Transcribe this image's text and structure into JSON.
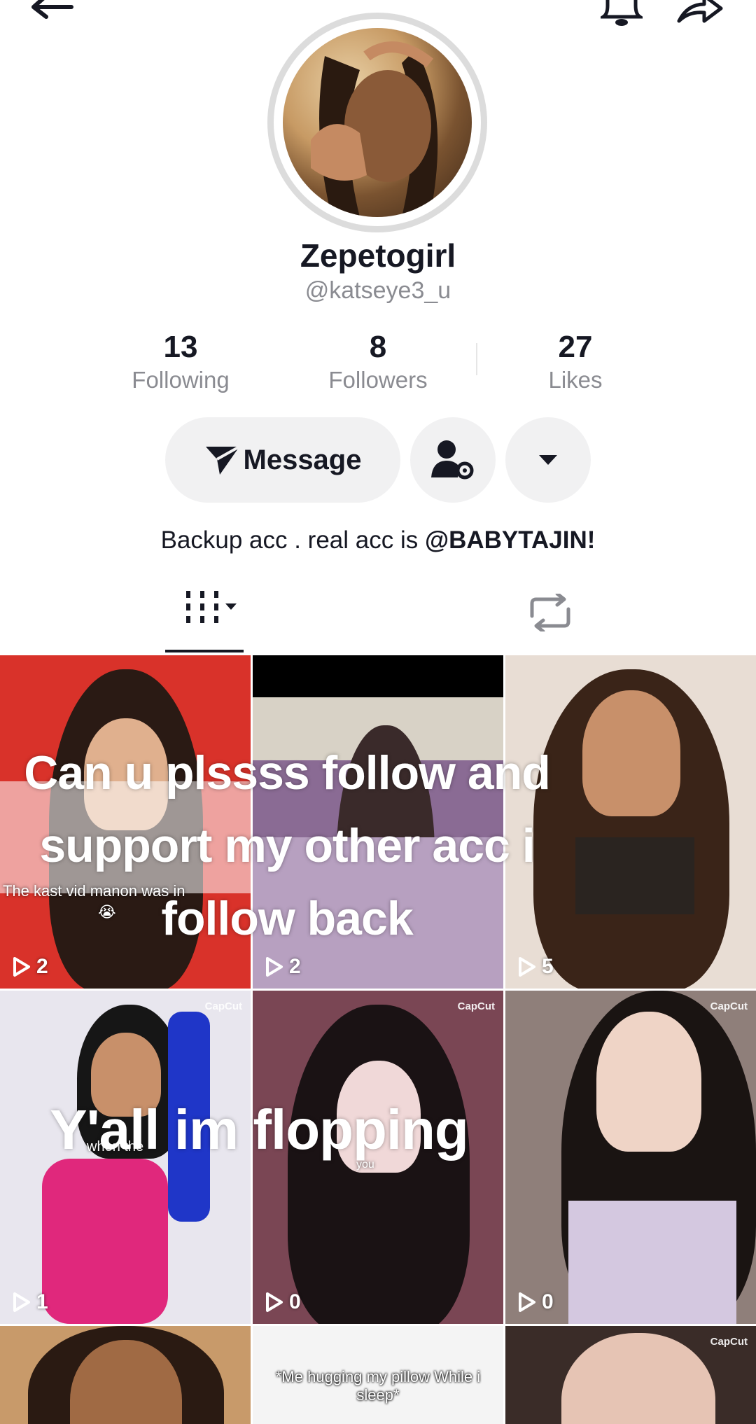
{
  "profile": {
    "display_name": "Zepetogirl",
    "username": "@katseye3_u",
    "bio_prefix": "Backup acc . real acc is ",
    "bio_mention": "@BABYTAJIN!"
  },
  "stats": [
    {
      "value": "13",
      "label": "Following"
    },
    {
      "value": "8",
      "label": "Followers"
    },
    {
      "value": "27",
      "label": "Likes"
    }
  ],
  "actions": {
    "message_label": "Message"
  },
  "overlay": {
    "line1": "Can u plssss follow and",
    "line2": "support my other acc i",
    "line3": "follow back",
    "line4": "Y'all im  flopping"
  },
  "videos": [
    {
      "views": "2",
      "caption": "The kast vid manon was in",
      "emoji": "😭",
      "color": "#d9322a"
    },
    {
      "views": "2",
      "color": "#8a6b94"
    },
    {
      "views": "5",
      "color": "#b79a7c"
    },
    {
      "views": "1",
      "caption": "when the",
      "brand": "CapCut",
      "color": "#e8e6ee"
    },
    {
      "views": "0",
      "caption": "you",
      "brand": "CapCut",
      "color": "#7a4654"
    },
    {
      "views": "0",
      "brand": "CapCut",
      "color": "#8f7f7a"
    },
    {
      "color": "#c89a6a"
    },
    {
      "caption": "*Me hugging my pillow While i sleep*",
      "color": "#f4f4f4"
    },
    {
      "brand": "CapCut",
      "color": "#3a2c28"
    }
  ],
  "colors": {
    "text_primary": "#161823",
    "text_secondary": "#8a8b91",
    "button_bg": "#f1f1f2"
  },
  "icons": [
    "back-arrow-icon",
    "bell-icon",
    "share-icon",
    "send-icon",
    "person-settings-icon",
    "dropdown-icon",
    "grid-icon",
    "repost-icon",
    "play-icon"
  ]
}
